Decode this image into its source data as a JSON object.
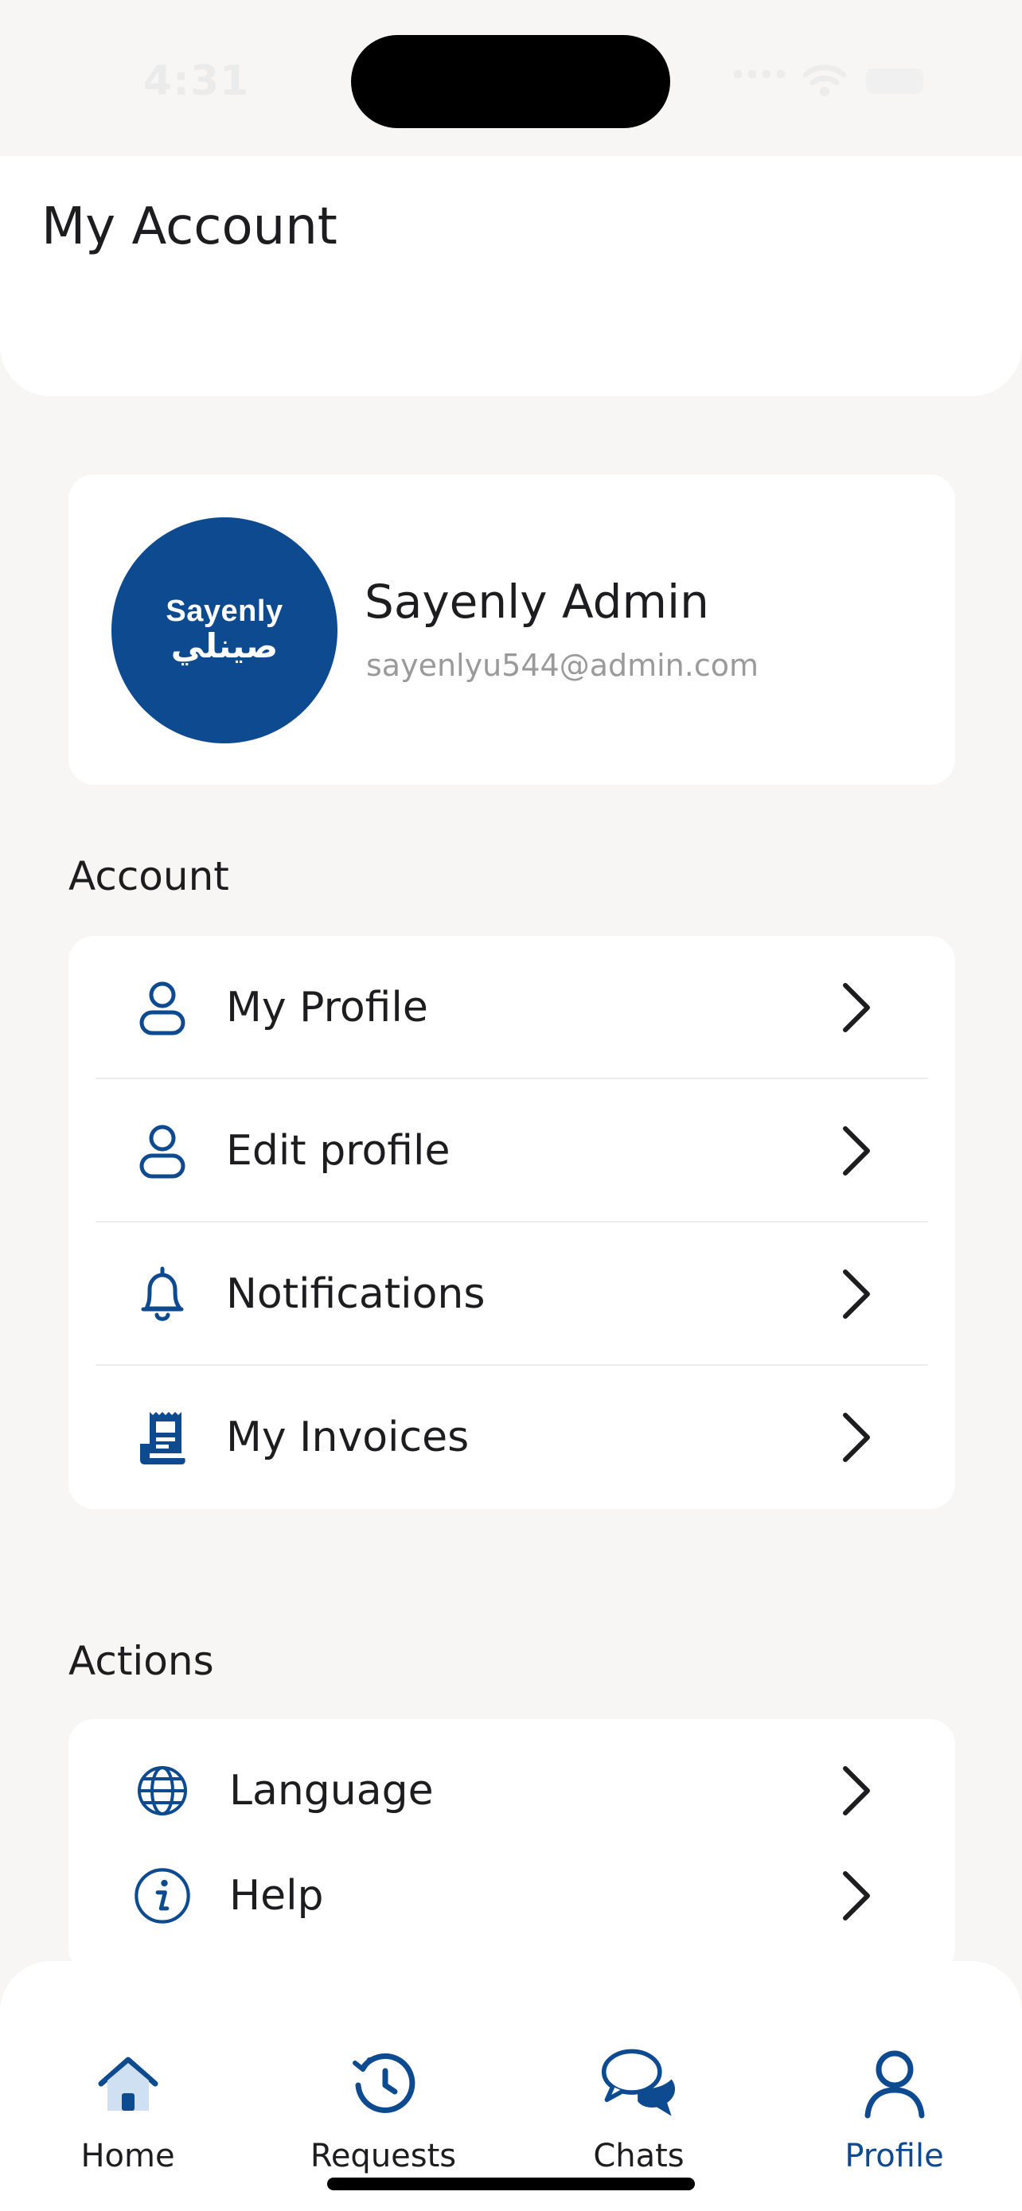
{
  "status_bar": {
    "time": "4:31"
  },
  "header": {
    "title": "My Account"
  },
  "profile": {
    "avatar_brand_en": "Sayenly",
    "avatar_brand_ar": "صينلي",
    "name": "Sayenly Admin",
    "email": "sayenlyu544@admin.com"
  },
  "account_section": {
    "title": "Account",
    "items": [
      {
        "label": "My Profile",
        "icon": "user-icon"
      },
      {
        "label": "Edit profile",
        "icon": "user-icon"
      },
      {
        "label": "Notifications",
        "icon": "bell-icon"
      },
      {
        "label": "My Invoices",
        "icon": "receipt-icon"
      }
    ]
  },
  "actions_section": {
    "title": "Actions",
    "items": [
      {
        "label": "Language",
        "icon": "globe-icon"
      },
      {
        "label": "Help",
        "icon": "info-icon"
      }
    ]
  },
  "bottom_nav": {
    "items": [
      {
        "label": "Home",
        "icon": "home-icon"
      },
      {
        "label": "Requests",
        "icon": "history-icon"
      },
      {
        "label": "Chats",
        "icon": "chat-bubbles-icon"
      },
      {
        "label": "Profile",
        "icon": "person-icon"
      }
    ],
    "active": "Profile"
  },
  "colors": {
    "brand": "#0d4a8f",
    "background": "#f7f6f4",
    "card": "#ffffff",
    "secondary_text": "#9a9a9a"
  }
}
